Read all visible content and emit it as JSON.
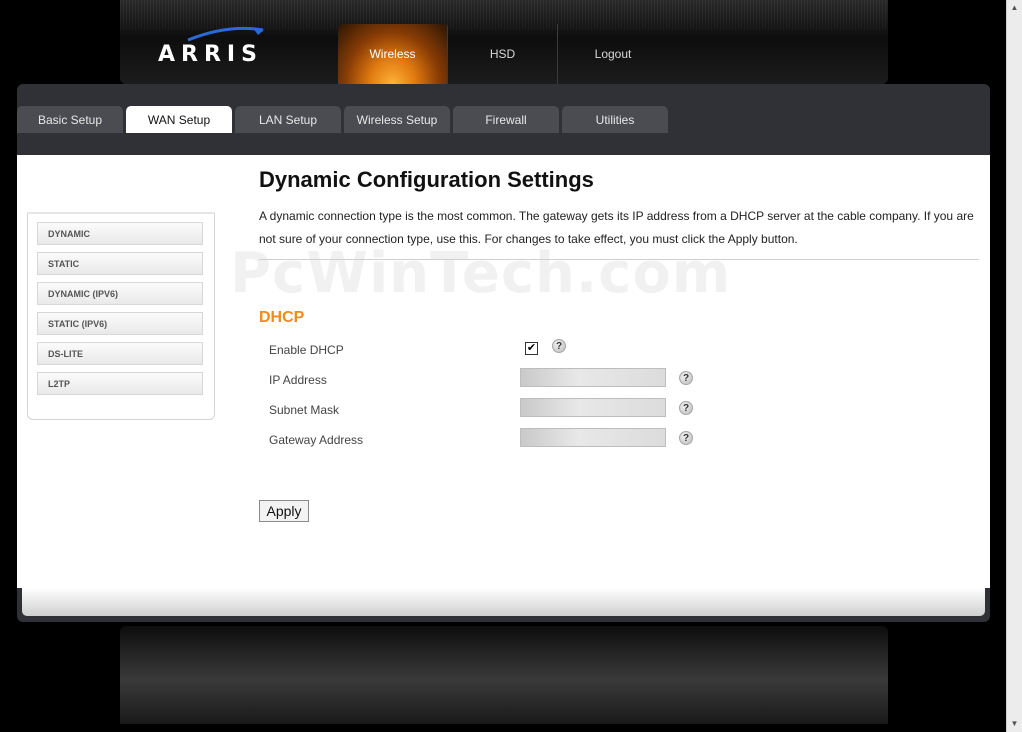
{
  "brand": {
    "name": "ARRIS"
  },
  "topnav": [
    {
      "label": "Wireless",
      "active": true
    },
    {
      "label": "HSD",
      "active": false
    },
    {
      "label": "Logout",
      "active": false
    }
  ],
  "tabs": [
    {
      "label": "Basic Setup",
      "active": false
    },
    {
      "label": "WAN Setup",
      "active": true
    },
    {
      "label": "LAN Setup",
      "active": false
    },
    {
      "label": "Wireless Setup",
      "active": false
    },
    {
      "label": "Firewall",
      "active": false
    },
    {
      "label": "Utilities",
      "active": false
    }
  ],
  "sidebar": {
    "items": [
      {
        "label": "DYNAMIC"
      },
      {
        "label": "STATIC"
      },
      {
        "label": "DYNAMIC (IPV6)"
      },
      {
        "label": "STATIC (IPV6)"
      },
      {
        "label": "DS-LITE"
      },
      {
        "label": "L2TP"
      }
    ]
  },
  "main": {
    "title": "Dynamic Configuration Settings",
    "description": "A dynamic connection type is the most common. The gateway gets its IP address from a DHCP server at the cable company. If you are not sure of your connection type, use this. For changes to take effect, you must click the Apply button.",
    "watermark": "PcWinTech.com",
    "section_title": "DHCP",
    "fields": {
      "enable_dhcp": {
        "label": "Enable DHCP",
        "checked": true
      },
      "ip_address": {
        "label": "IP Address",
        "value": ""
      },
      "subnet_mask": {
        "label": "Subnet Mask",
        "value": ""
      },
      "gateway_address": {
        "label": "Gateway Address",
        "value": ""
      }
    },
    "help_glyph": "?",
    "apply_label": "Apply"
  },
  "colors": {
    "accent_orange": "#f08c1a",
    "panel": "#2f3136",
    "tab": "#4a4c52"
  },
  "icons": {
    "help": "help-icon",
    "checkmark": "checkmark-icon",
    "logo": "arris-logo-icon"
  }
}
